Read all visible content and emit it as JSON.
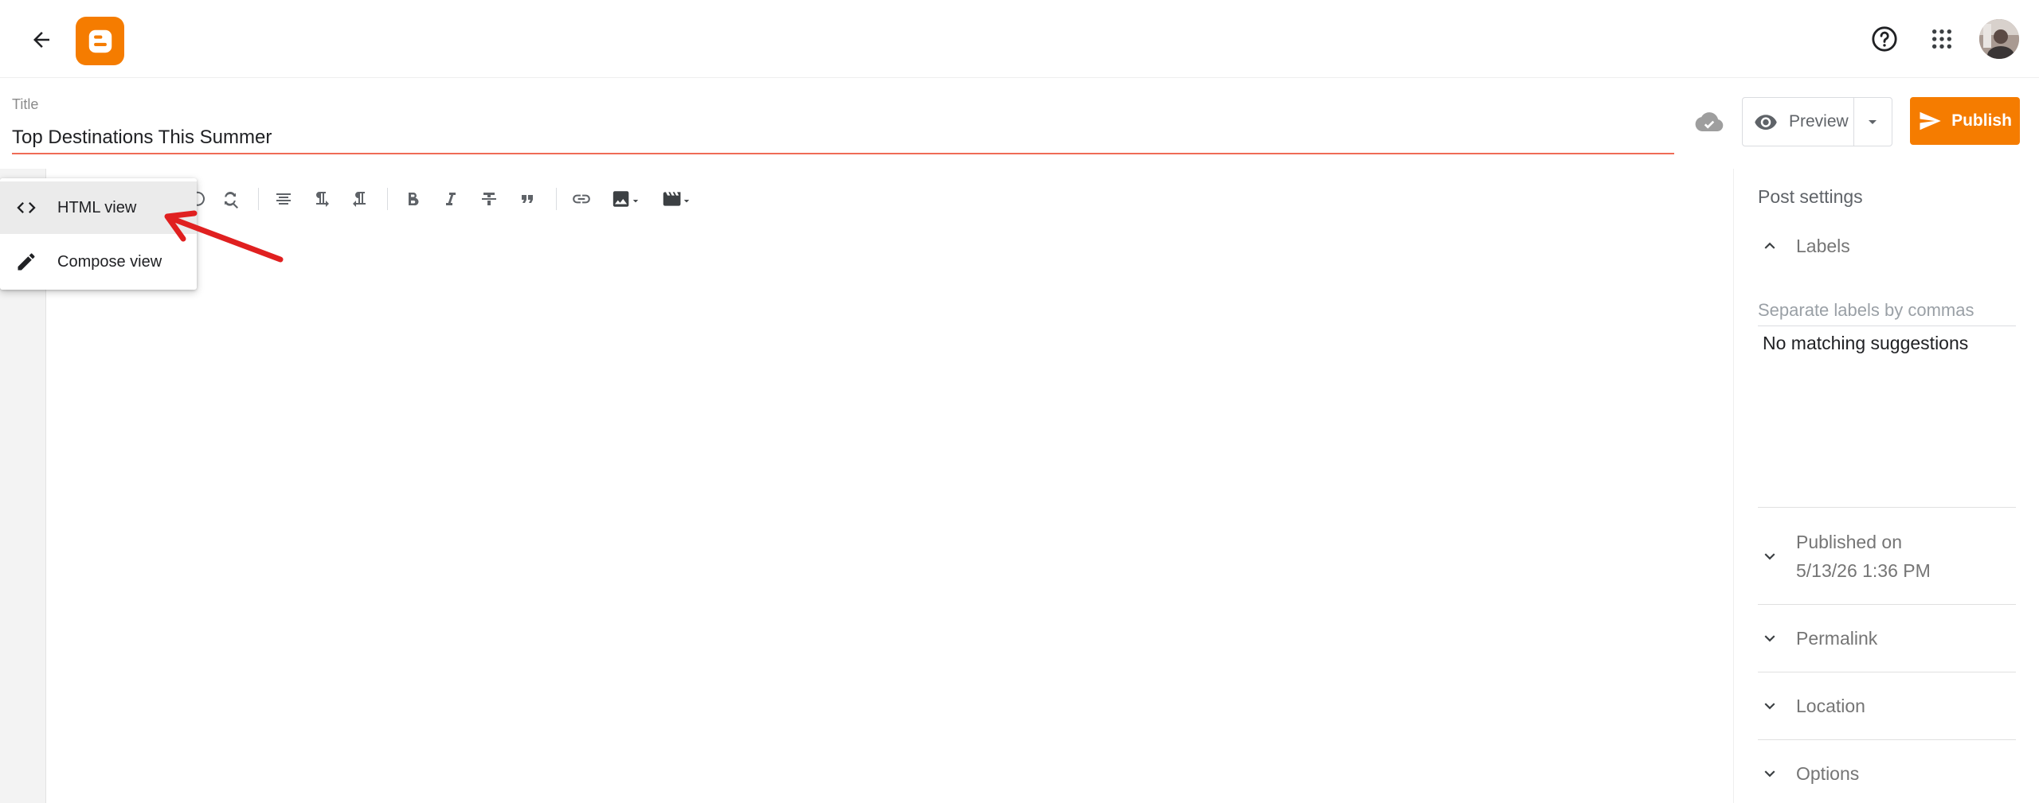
{
  "header": {
    "back_icon": "arrow-back-icon",
    "logo": "blogger-logo",
    "brand_color": "#f57c00",
    "help_icon": "help-icon",
    "apps_icon": "apps-grid-icon",
    "avatar": "user-avatar"
  },
  "editor": {
    "title_label": "Title",
    "title_value": "Top Destinations This Summer",
    "save_status_icon": "cloud-done-icon",
    "preview_label": "Preview",
    "publish_label": "Publish",
    "accent_underline": "#ef6c57"
  },
  "mode_menu": {
    "items": [
      {
        "label": "HTML view",
        "icon": "code-icon"
      },
      {
        "label": "Compose view",
        "icon": "pencil-icon"
      }
    ]
  },
  "toolbar": {
    "icons": [
      "find-replace-icon",
      "align-icon",
      "ltr-icon",
      "rtl-icon",
      "bold-icon",
      "italic-icon",
      "strikethrough-icon",
      "quote-icon",
      "link-icon",
      "image-icon",
      "video-icon"
    ]
  },
  "settings": {
    "heading": "Post settings",
    "labels_title": "Labels",
    "labels_placeholder": "Separate labels by commas",
    "no_suggestions": "No matching suggestions",
    "published_on_line1": "Published on",
    "published_on_line2": "5/13/26 1:36 PM",
    "permalink": "Permalink",
    "location": "Location",
    "options": "Options"
  }
}
